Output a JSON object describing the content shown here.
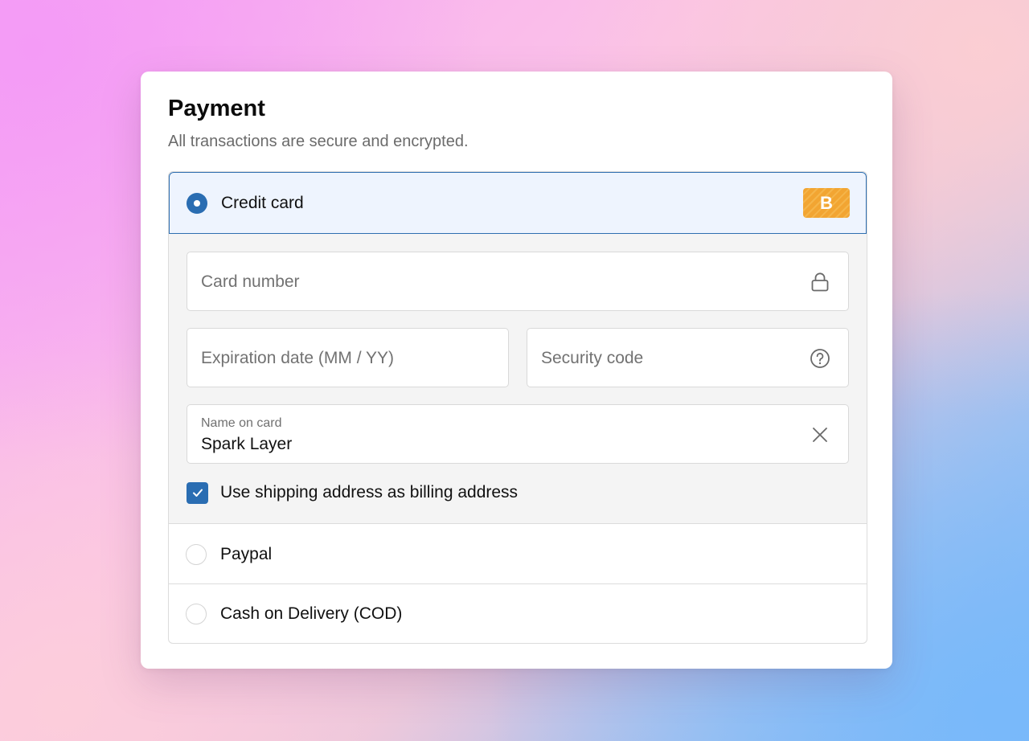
{
  "payment": {
    "title": "Payment",
    "subtitle": "All transactions are secure and encrypted."
  },
  "methods": {
    "credit_card": {
      "label": "Credit card",
      "selected": true,
      "brand_badge": "B",
      "brand_color": "#f2a532"
    },
    "paypal": {
      "label": "Paypal",
      "selected": false
    },
    "cod": {
      "label": "Cash on Delivery (COD)",
      "selected": false
    }
  },
  "card_form": {
    "card_number": {
      "placeholder": "Card number",
      "icon": "lock-icon"
    },
    "expiration": {
      "placeholder": "Expiration date (MM / YY)"
    },
    "security_code": {
      "placeholder": "Security code",
      "icon": "help-circle-icon"
    },
    "name_on_card": {
      "label": "Name on card",
      "value": "Spark Layer",
      "icon": "close-icon"
    },
    "billing_checkbox": {
      "label": "Use shipping address as billing address",
      "checked": true
    }
  },
  "colors": {
    "accent": "#2a6db2",
    "selected_background": "#eef4fe",
    "panel_background": "#f4f4f4"
  }
}
